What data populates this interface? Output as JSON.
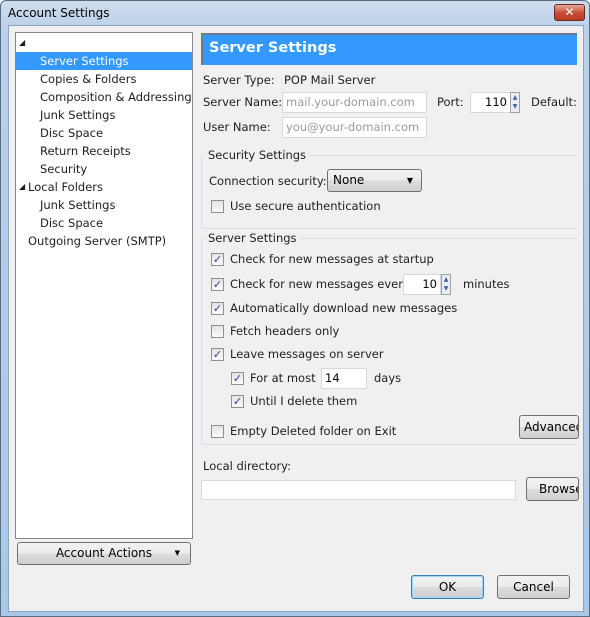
{
  "window": {
    "title": "Account Settings",
    "close_icon": "close-icon"
  },
  "tree": {
    "items": [
      {
        "label": "",
        "level": 0,
        "expanded": true
      },
      {
        "label": "Server Settings",
        "level": 1,
        "selected": true
      },
      {
        "label": "Copies & Folders",
        "level": 1
      },
      {
        "label": "Composition & Addressing",
        "level": 1
      },
      {
        "label": "Junk Settings",
        "level": 1
      },
      {
        "label": "Disc Space",
        "level": 1
      },
      {
        "label": "Return Receipts",
        "level": 1
      },
      {
        "label": "Security",
        "level": 1
      },
      {
        "label": "Local Folders",
        "level": 0,
        "expanded": true
      },
      {
        "label": "Junk Settings",
        "level": 1
      },
      {
        "label": "Disc Space",
        "level": 1
      },
      {
        "label": "Outgoing Server (SMTP)",
        "level": 0
      }
    ]
  },
  "account_actions": "Account Actions",
  "panel": {
    "title": "Server Settings",
    "server_type_label": "Server Type:",
    "server_type": "POP Mail Server",
    "server_name_label": "Server Name:",
    "server_name_placeholder": "mail.your-domain.com",
    "port_label": "Port:",
    "port": "110",
    "default_label": "Default:",
    "user_name_label": "User Name:",
    "user_name_placeholder": "you@your-domain.com",
    "security": {
      "legend": "Security Settings",
      "connection_label": "Connection security:",
      "connection_value": "None",
      "secure_auth": {
        "label": "Use secure authentication",
        "checked": false
      }
    },
    "server": {
      "legend": "Server Settings",
      "check_startup": {
        "label": "Check for new messages at startup",
        "checked": true
      },
      "check_every": {
        "label": "Check for new messages every",
        "checked": true,
        "value": "10",
        "unit": "minutes"
      },
      "auto_download": {
        "label": "Automatically download new messages",
        "checked": true
      },
      "headers_only": {
        "label": "Fetch headers only",
        "checked": false
      },
      "leave_on_server": {
        "label": "Leave messages on server",
        "checked": true
      },
      "for_at_most": {
        "label": "For at most",
        "checked": true,
        "value": "14",
        "unit": "days"
      },
      "until_delete": {
        "label": "Until I delete them",
        "checked": true
      },
      "empty_deleted": {
        "label": "Empty Deleted folder on Exit",
        "checked": false
      },
      "advanced": "Advanced..."
    },
    "local_directory_label": "Local directory:",
    "local_directory": "",
    "browse": "Browse..."
  },
  "ok": "OK",
  "cancel": "Cancel"
}
